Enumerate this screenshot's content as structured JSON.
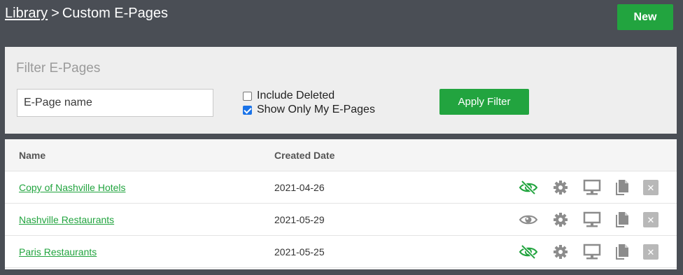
{
  "header": {
    "breadcrumb_link": "Library",
    "breadcrumb_sep": ">",
    "breadcrumb_current": "Custom E-Pages",
    "new_label": "New"
  },
  "filter": {
    "title": "Filter E-Pages",
    "name_placeholder": "E-Page name",
    "include_deleted_label": "Include Deleted",
    "include_deleted_checked": false,
    "only_mine_label": "Show Only My E-Pages",
    "only_mine_checked": true,
    "apply_label": "Apply Filter"
  },
  "table": {
    "columns": {
      "name": "Name",
      "date": "Created Date"
    },
    "rows": [
      {
        "name": "Copy of Nashville Hotels",
        "date": "2021-04-26",
        "visibility_icon": "eye-slash-icon"
      },
      {
        "name": "Nashville Restaurants",
        "date": "2021-05-29",
        "visibility_icon": "eye-icon"
      },
      {
        "name": "Paris Restaurants",
        "date": "2021-05-25",
        "visibility_icon": "eye-slash-icon"
      }
    ],
    "icons": [
      "gear-icon",
      "monitor-icon",
      "copy-icon",
      "delete-icon"
    ]
  },
  "colors": {
    "accent_green": "#22a43f",
    "header_bg": "#4a4e55",
    "icon_gray": "#8c8c8c"
  }
}
